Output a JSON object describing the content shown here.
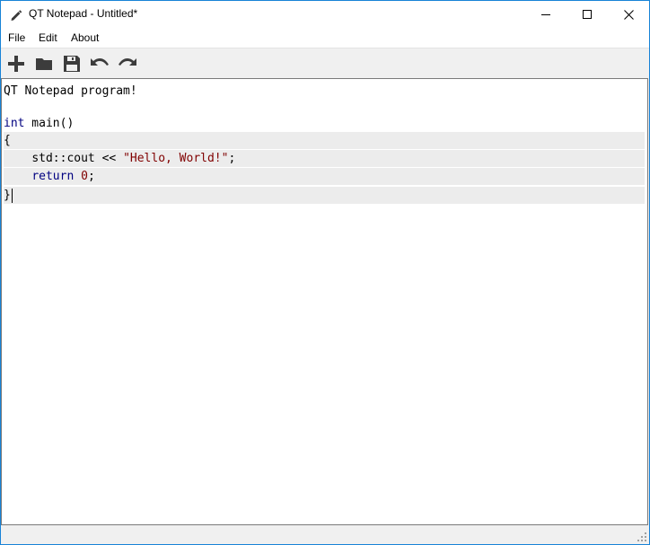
{
  "window": {
    "title": "QT Notepad - Untitled*"
  },
  "menu": {
    "items": [
      "File",
      "Edit",
      "About"
    ]
  },
  "toolbar": {
    "icons": [
      "plus-icon",
      "folder-icon",
      "save-icon",
      "undo-icon",
      "redo-icon"
    ]
  },
  "editor": {
    "lines": [
      {
        "text": "QT Notepad program!"
      },
      {
        "text": ""
      },
      {
        "kw": "int",
        "text": " main()"
      },
      {
        "text": "{"
      },
      {
        "indent": "    ",
        "text": "std::cout << ",
        "str": "\"Hello, World!\"",
        "tail": ";"
      },
      {
        "indent": "    ",
        "kw": "return",
        "sp": " ",
        "num": "0",
        "tail": ";"
      },
      {
        "text": "}"
      }
    ]
  },
  "colors": {
    "accent": "#1883d7",
    "keyword": "#000080",
    "string": "#800000",
    "highlight": "#ececec"
  }
}
